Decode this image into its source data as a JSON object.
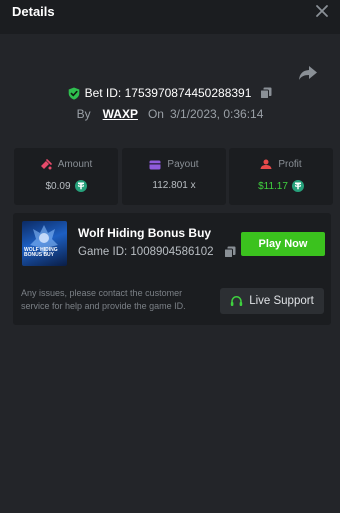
{
  "header": {
    "title": "Details",
    "close_icon": "close-icon"
  },
  "bet": {
    "id_text": "Bet ID: 1753970874450288391",
    "by_label": "By",
    "username": "WAXP",
    "on_label": "On",
    "date": "3/1/2023, 0:36:14",
    "share_icon": "share-icon",
    "verified_icon": "shield-check-icon",
    "copy_icon": "copy-icon"
  },
  "stats": [
    {
      "label": "Amount",
      "value": "$0.09",
      "icon": "amount-icon",
      "coin": true,
      "color": "#e84a6a"
    },
    {
      "label": "Payout",
      "value": "112.801 x",
      "icon": "wallet-icon",
      "coin": false,
      "color": "#8f5bdc"
    },
    {
      "label": "Profit",
      "value": "$11.17",
      "icon": "profit-icon",
      "coin": true,
      "color": "#e84a4a"
    }
  ],
  "game": {
    "title": "Wolf Hiding Bonus Buy",
    "id_text": "Game ID: 1008904586102",
    "thumbnail_text": "WOLF HIDING BONUS BUY",
    "play_label": "Play Now",
    "help_text": "Any issues, please contact the customer service for help and provide the game ID.",
    "support_label": "Live Support",
    "support_icon": "headset-icon"
  },
  "colors": {
    "background": "#232529",
    "panel": "#1b1d20",
    "accent_green": "#3bc21e",
    "profit_green": "#3fd23f",
    "coin_teal": "#26a17b"
  }
}
